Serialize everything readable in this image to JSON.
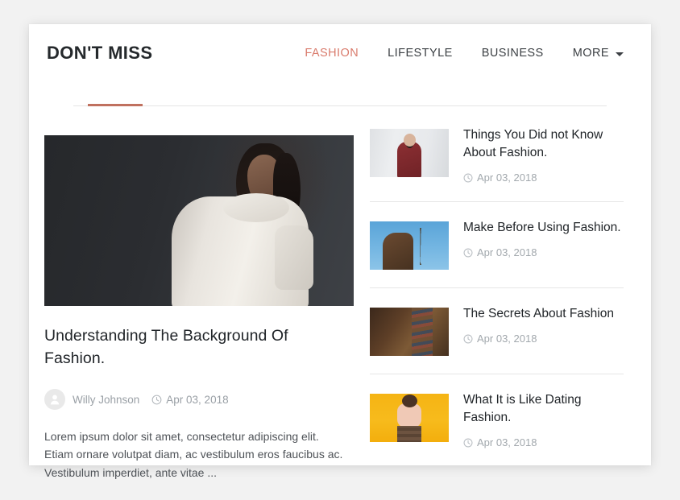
{
  "header": {
    "brand_title": "DON'T MISS",
    "nav": [
      {
        "label": "FASHION",
        "active": true
      },
      {
        "label": "LIFESTYLE",
        "active": false
      },
      {
        "label": "BUSINESS",
        "active": false
      },
      {
        "label": "MORE",
        "active": false,
        "caret": true
      }
    ],
    "accent_color": "#c0715f"
  },
  "featured": {
    "image_name": "woman-in-white-knit-sweater",
    "title": "Understanding The Background Of Fashion.",
    "author": "Willy Johnson",
    "date": "Apr 03, 2018",
    "excerpt": "Lorem ipsum dolor sit amet, consectetur adipiscing elit. Etiam ornare volutpat diam, ac vestibulum eros faucibus ac. Vestibulum imperdiet, ante vitae ..."
  },
  "sidebar": {
    "items": [
      {
        "title": "Things You Did not Know About Fashion.",
        "date": "Apr 03, 2018",
        "thumb_name": "woman-shopping-red-coat"
      },
      {
        "title": "Make Before Using Fashion.",
        "date": "Apr 03, 2018",
        "thumb_name": "woman-blue-sky-outdoors"
      },
      {
        "title": "The Secrets About Fashion",
        "date": "Apr 03, 2018",
        "thumb_name": "woman-earth-tones-textile"
      },
      {
        "title": "What It is Like Dating Fashion.",
        "date": "Apr 03, 2018",
        "thumb_name": "woman-yellow-backdrop"
      }
    ]
  }
}
